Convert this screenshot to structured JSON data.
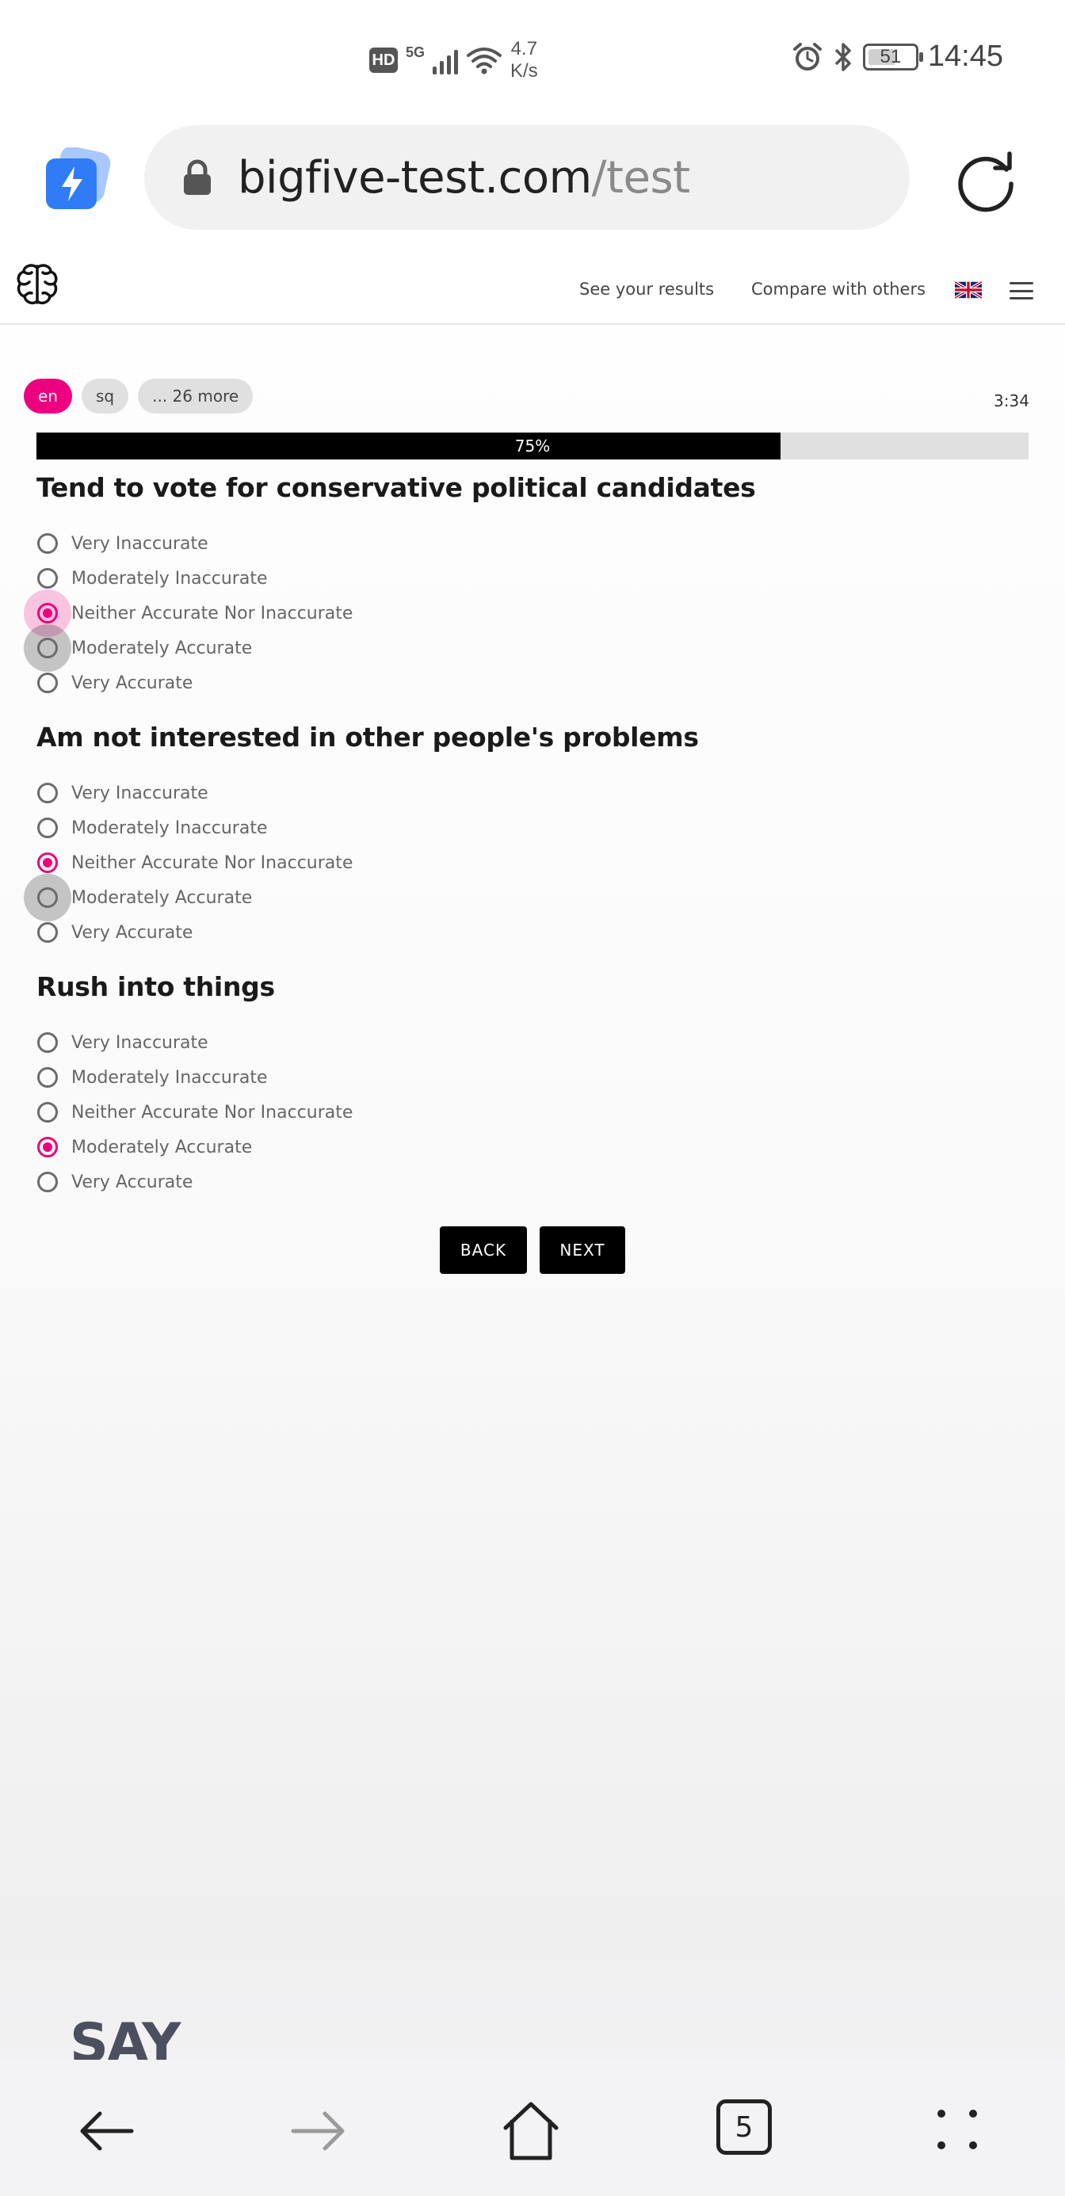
{
  "status_bar": {
    "hd_label": "HD",
    "network_label": "5G",
    "speed_value": "4.7",
    "speed_unit": "K/s",
    "battery_level": "51",
    "time": "14:45"
  },
  "browser": {
    "url_domain": "bigfive-test.com",
    "url_path": "/test"
  },
  "header": {
    "nav_results": "See your results",
    "nav_compare": "Compare with others"
  },
  "languages": {
    "active": "en",
    "second": "sq",
    "more": "... 26 more"
  },
  "timer": "3:34",
  "progress": {
    "label": "75%",
    "value": 0.75
  },
  "questions": [
    {
      "title": "Tend to vote for conservative political candidates",
      "options": [
        "Very Inaccurate",
        "Moderately Inaccurate",
        "Neither Accurate Nor Inaccurate",
        "Moderately Accurate",
        "Very Accurate"
      ],
      "selected": 2
    },
    {
      "title": "Am not interested in other people's problems",
      "options": [
        "Very Inaccurate",
        "Moderately Inaccurate",
        "Neither Accurate Nor Inaccurate",
        "Moderately Accurate",
        "Very Accurate"
      ],
      "selected": 2
    },
    {
      "title": "Rush into things",
      "options": [
        "Very Inaccurate",
        "Moderately Inaccurate",
        "Neither Accurate Nor Inaccurate",
        "Moderately Accurate",
        "Very Accurate"
      ],
      "selected": 3
    }
  ],
  "buttons": {
    "back": "BACK",
    "next": "NEXT"
  },
  "ad_text": "SAY",
  "bottom_nav": {
    "tab_count": "5"
  },
  "colors": {
    "accent": "#ed007f",
    "progress_fill": "#000000"
  }
}
